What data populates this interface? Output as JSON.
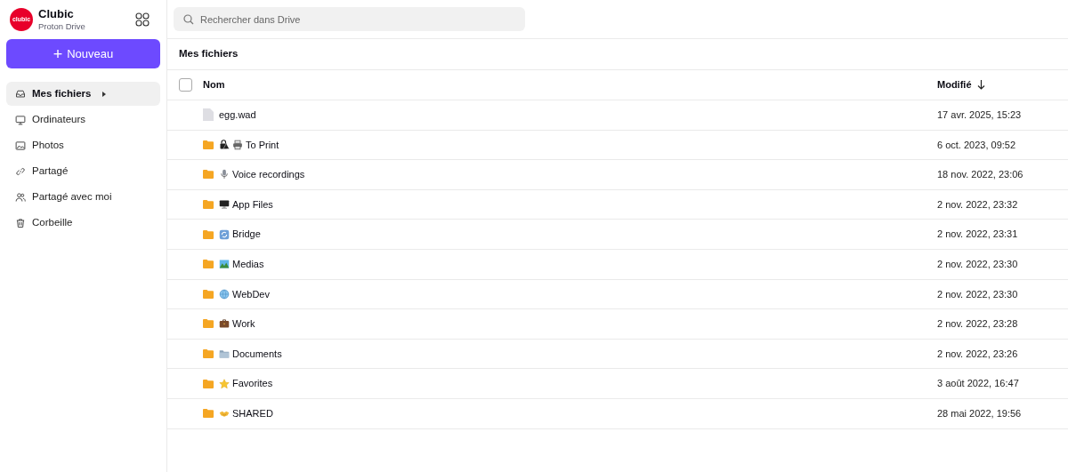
{
  "brand": {
    "logo": "clubic",
    "name": "Clubic",
    "product": "Proton Drive"
  },
  "new_button": {
    "icon": "+",
    "label": "Nouveau"
  },
  "sidebar": {
    "items": [
      {
        "kind": "inbox",
        "label": "Mes fichiers",
        "selected": true
      },
      {
        "kind": "monitor",
        "label": "Ordinateurs",
        "selected": false
      },
      {
        "kind": "image",
        "label": "Photos",
        "selected": false
      },
      {
        "kind": "link",
        "label": "Partagé",
        "selected": false
      },
      {
        "kind": "people",
        "label": "Partagé avec moi",
        "selected": false
      },
      {
        "kind": "trash",
        "label": "Corbeille",
        "selected": false
      }
    ]
  },
  "search": {
    "placeholder": "Rechercher dans Drive"
  },
  "breadcrumb": "Mes fichiers",
  "table": {
    "select_all": {
      "checked": false
    },
    "columns": [
      "Nom",
      "Modifié"
    ],
    "rows": [
      {
        "kind": "file",
        "name": "egg.wad",
        "modified": "17 avr. 2025, 15:23"
      },
      {
        "kind": "printer",
        "name": "To Print",
        "modified": "6 oct. 2023, 09:52"
      },
      {
        "kind": "microphone",
        "name": "Voice recordings",
        "modified": "18 nov. 2022, 23:06"
      },
      {
        "kind": "monitor",
        "name": "App Files",
        "modified": "2 nov. 2022, 23:32"
      },
      {
        "kind": "sync",
        "name": "Bridge",
        "modified": "2 nov. 2022, 23:31"
      },
      {
        "kind": "landscape",
        "name": "Medias",
        "modified": "2 nov. 2022, 23:30"
      },
      {
        "kind": "globe",
        "name": "WebDev",
        "modified": "2 nov. 2022, 23:30"
      },
      {
        "kind": "briefcase",
        "name": "Work",
        "modified": "2 nov. 2022, 23:28"
      },
      {
        "kind": "folder",
        "name": "Documents",
        "modified": "2 nov. 2022, 23:26"
      },
      {
        "kind": "star",
        "name": "Favorites",
        "modified": "3 août 2022, 16:47"
      },
      {
        "kind": "handshake",
        "name": "SHARED",
        "modified": "28 mai 2022, 19:56"
      }
    ]
  }
}
